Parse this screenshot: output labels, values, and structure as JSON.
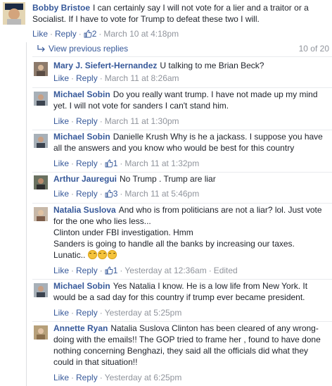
{
  "top_comment": {
    "author": "Bobby Bristoe",
    "text": "I can certainly say I will not vote for a lier and a traitor or a Socialist. If I have to vote for Trump to defeat these two I will.",
    "like": "Like",
    "reply": "Reply",
    "likes": "2",
    "time": "March 10 at 4:18pm"
  },
  "view_previous": {
    "label": "View previous replies",
    "count": "10 of 20"
  },
  "replies": [
    {
      "author": "Mary J. Siefert-Hernandez",
      "text": "U talking to me Brian Beck?",
      "likes": "",
      "time": "March 11 at 8:26am",
      "edited": ""
    },
    {
      "author": "Michael Sobin",
      "text": "Do you really want trump. I have not made up my mind yet. I will not vote for sanders I can't stand him.",
      "likes": "",
      "time": "March 11 at 1:30pm",
      "edited": ""
    },
    {
      "author": "Michael Sobin",
      "text": "Danielle Krush Why is he a jackass. I suppose you have all the answers and you know who would be best for this country",
      "likes": "1",
      "time": "March 11 at 1:32pm",
      "edited": ""
    },
    {
      "author": "Arthur Jauregui",
      "text": "No Trump . Trump are liar",
      "likes": "3",
      "time": "March 11 at 5:46pm",
      "edited": ""
    },
    {
      "author": "Natalia Suslova",
      "text": "And who is from politicians are not a liar? lol. Just vote for the one who lies less...",
      "line2": "Clinton under FBI investigation. Hmm",
      "line3": "Sanders is going to handle all the banks by increasing our taxes.",
      "line4": "Lunatic..",
      "likes": "1",
      "time": "Yesterday at 12:36am",
      "edited": "Edited"
    },
    {
      "author": "Michael Sobin",
      "text": "Yes Natalia I know. He is a low life from New York. It would be a sad day for this country if trump ever became president.",
      "likes": "",
      "time": "Yesterday at 5:25pm",
      "edited": ""
    },
    {
      "author": "Annette Ryan",
      "text": "Natalia Suslova Clinton has been cleared of any wrong-doing with the emails!! The GOP tried to frame her , found to have done nothing concerning Benghazi, they said all the officials did what they could in that situation!!",
      "likes": "",
      "time": "Yesterday at 6:25pm",
      "edited": ""
    }
  ],
  "labels": {
    "like": "Like",
    "reply": "Reply"
  },
  "colors": {
    "link": "#365899",
    "meta": "#90949c",
    "text": "#1d2129"
  }
}
